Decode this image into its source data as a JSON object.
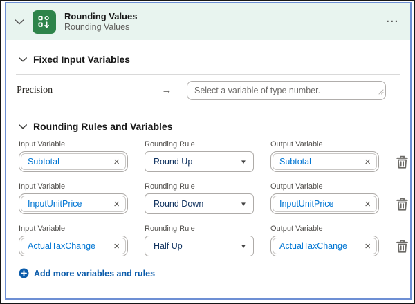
{
  "header": {
    "title": "Rounding Values",
    "subtitle": "Rounding Values",
    "more_label": "..."
  },
  "sections": {
    "fixed_title": "Fixed Input Variables",
    "rules_title": "Rounding Rules and Variables"
  },
  "precision": {
    "label": "Precision",
    "arrow": "→",
    "placeholder": "Select a variable of type number."
  },
  "columns": {
    "input": "Input Variable",
    "rule": "Rounding Rule",
    "output": "Output Variable"
  },
  "rows": [
    {
      "input": "Subtotal",
      "rule": "Round Up",
      "output": "Subtotal"
    },
    {
      "input": "InputUnitPrice",
      "rule": "Round Down",
      "output": "InputUnitPrice"
    },
    {
      "input": "ActualTaxChange",
      "rule": "Half Up",
      "output": "ActualTaxChange"
    }
  ],
  "icons": {
    "remove": "×",
    "dropdown": "▼"
  },
  "add_link": {
    "label": "Add more variables and rules"
  },
  "colors": {
    "header_bg": "#e8f4ef",
    "icon_green": "#2e844a",
    "card_border": "#6d8fd4",
    "pill_text": "#0176d3",
    "rule_text": "#10325f",
    "link": "#0b5cab"
  }
}
